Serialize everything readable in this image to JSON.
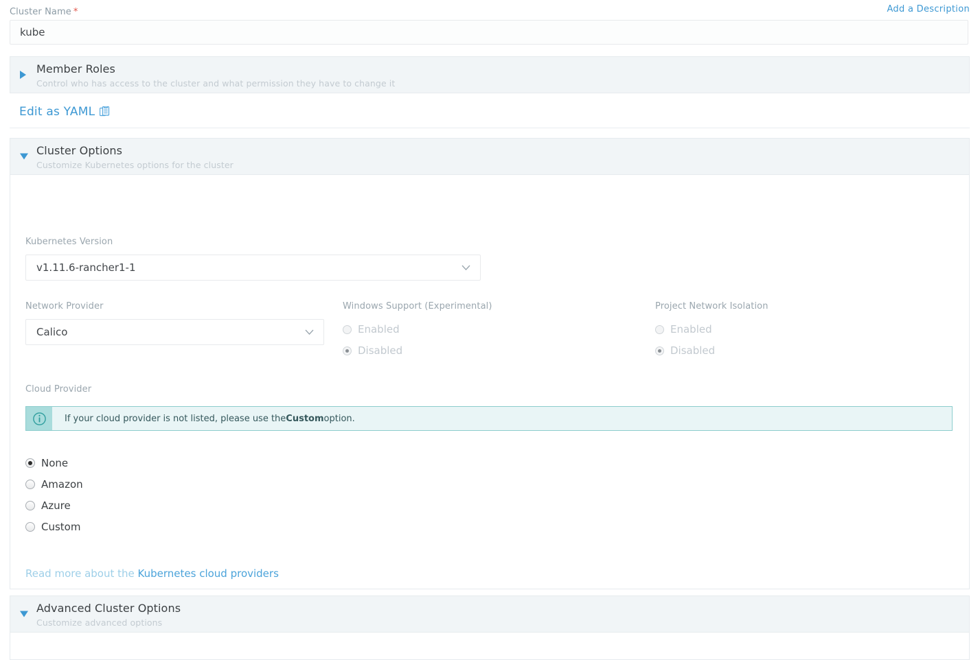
{
  "cluster_name": {
    "label": "Cluster Name",
    "required_marker": "*",
    "value": "kube",
    "add_description_link": "Add a Description"
  },
  "member_roles": {
    "title": "Member Roles",
    "subtitle": "Control who has access to the cluster and what permission they have to change it",
    "arrow_icon": "triangle-right-icon",
    "expanded": false
  },
  "yaml": {
    "label": "Edit as YAML",
    "icon": "clipboard-icon"
  },
  "cluster_options": {
    "title": "Cluster Options",
    "subtitle": "Customize Kubernetes options for the cluster",
    "arrow_icon": "triangle-down-icon",
    "expanded": true,
    "kubernetes_version": {
      "label": "Kubernetes Version",
      "value": "v1.11.6-rancher1-1",
      "chevron_icon": "chevron-down-icon"
    },
    "network_provider": {
      "label": "Network Provider",
      "value": "Calico",
      "chevron_icon": "chevron-down-icon"
    },
    "windows_support": {
      "label": "Windows Support (Experimental)",
      "options": [
        {
          "label": "Enabled",
          "checked": false,
          "disabled": true
        },
        {
          "label": "Disabled",
          "checked": true,
          "disabled": true
        }
      ]
    },
    "project_network_isolation": {
      "label": "Project Network Isolation",
      "options": [
        {
          "label": "Enabled",
          "checked": false,
          "disabled": true
        },
        {
          "label": "Disabled",
          "checked": true,
          "disabled": true
        }
      ]
    },
    "cloud_provider": {
      "label": "Cloud Provider",
      "banner": {
        "icon": "info-circle-icon",
        "text_before": "If your cloud provider is not listed, please use the ",
        "text_bold": "Custom",
        "text_after": " option."
      },
      "options": [
        {
          "label": "None",
          "checked": true
        },
        {
          "label": "Amazon",
          "checked": false
        },
        {
          "label": "Azure",
          "checked": false
        },
        {
          "label": "Custom",
          "checked": false
        }
      ],
      "read_more_prefix": "Read more about the ",
      "read_more_link": "Kubernetes cloud providers"
    }
  },
  "advanced_cluster_options": {
    "title": "Advanced Cluster Options",
    "subtitle": "Customize advanced options",
    "arrow_icon": "triangle-down-icon",
    "expanded": true
  },
  "colors": {
    "link": "#3d98d3",
    "required": "#e2574c",
    "header_bg": "#f1f5f7",
    "banner_bg": "#e9f5f6",
    "banner_accent": "#2f9e9e"
  }
}
